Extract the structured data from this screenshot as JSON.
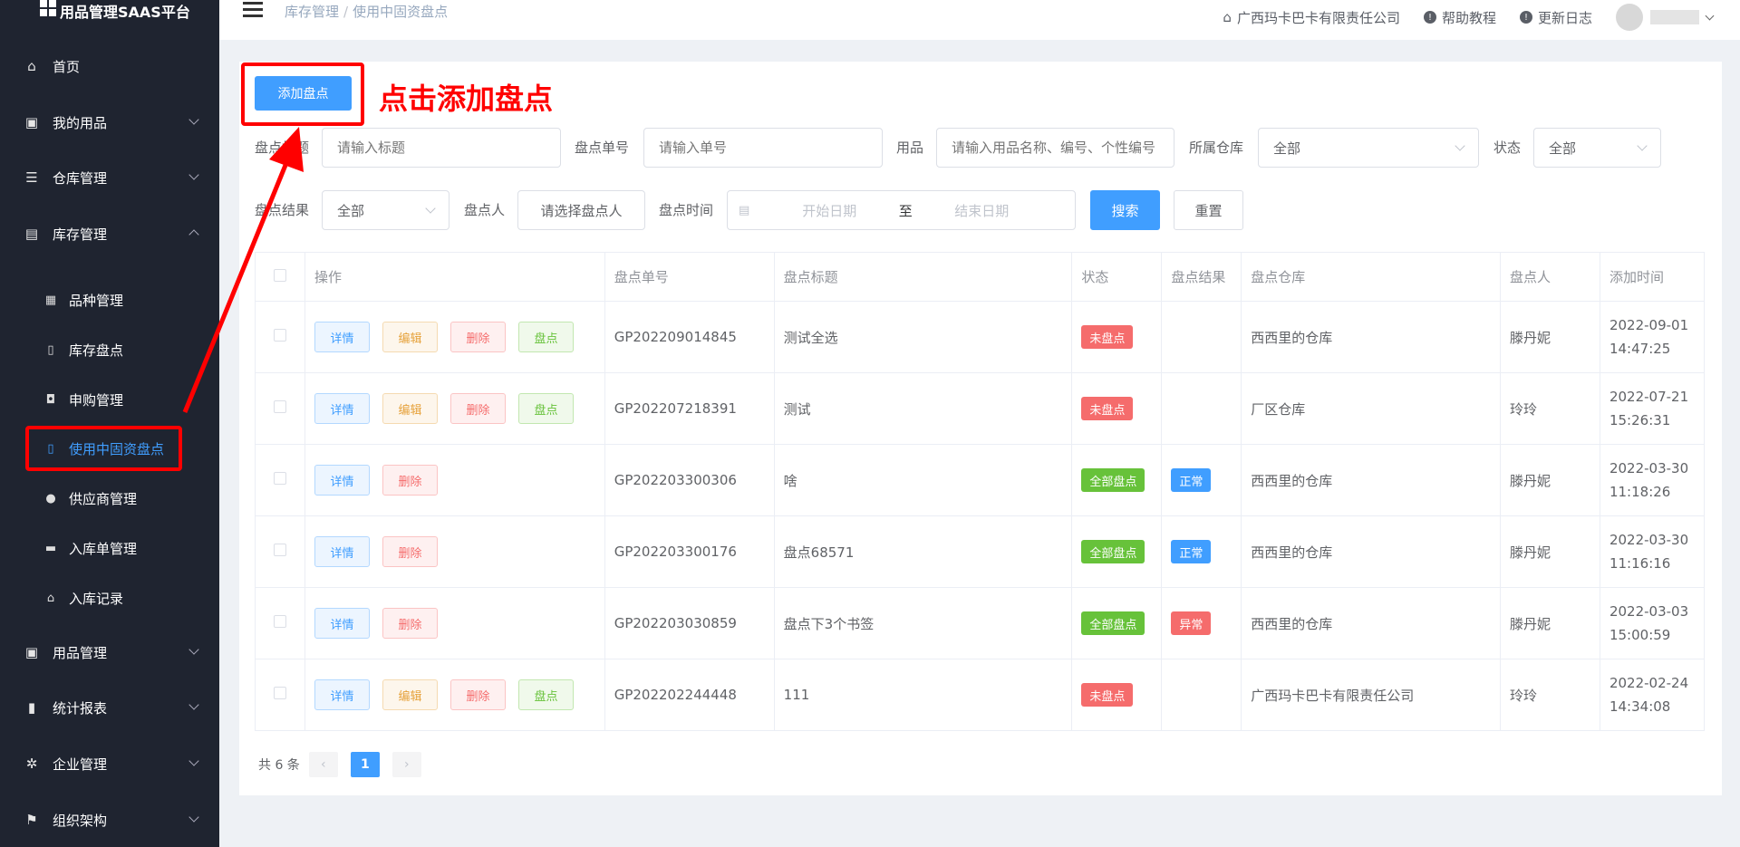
{
  "app": {
    "title": "用品管理SAAS平台"
  },
  "sidebar": {
    "items": [
      {
        "label": "首页",
        "icon": "home-icon"
      },
      {
        "label": "我的用品",
        "icon": "box-icon"
      },
      {
        "label": "仓库管理",
        "icon": "database-icon"
      },
      {
        "label": "库存管理",
        "icon": "inventory-icon"
      },
      {
        "label": "用品管理",
        "icon": "goods-icon"
      },
      {
        "label": "统计报表",
        "icon": "chart-icon"
      },
      {
        "label": "企业管理",
        "icon": "gear-icon"
      },
      {
        "label": "组织架构",
        "icon": "flag-icon"
      }
    ],
    "sub_items": [
      {
        "label": "品种管理",
        "icon": "grid-icon"
      },
      {
        "label": "库存盘点",
        "icon": "document-icon"
      },
      {
        "label": "申购管理",
        "icon": "bag-icon"
      },
      {
        "label": "使用中固资盘点",
        "icon": "document-icon"
      },
      {
        "label": "供应商管理",
        "icon": "user-icon"
      },
      {
        "label": "入库单管理",
        "icon": "printer-icon"
      },
      {
        "label": "入库记录",
        "icon": "home-icon"
      }
    ]
  },
  "header": {
    "breadcrumb": [
      "库存管理",
      "使用中固资盘点"
    ],
    "breadcrumb_sep": "/",
    "company": "广西玛卡巴卡有限责任公司",
    "help": "帮助教程",
    "changelog": "更新日志"
  },
  "annotation": {
    "text": "点击添加盘点",
    "color": "#ff0000"
  },
  "toolbar": {
    "add_label": "添加盘点"
  },
  "filters": {
    "title_label": "盘点标题",
    "title_placeholder": "请输入标题",
    "no_label": "盘点单号",
    "no_placeholder": "请输入单号",
    "goods_label": "用品",
    "goods_placeholder": "请输入用品名称、编号、个性编号",
    "warehouse_label": "所属仓库",
    "warehouse_value": "全部",
    "status_label": "状态",
    "status_value": "全部",
    "result_label": "盘点结果",
    "result_value": "全部",
    "person_label": "盘点人",
    "person_button": "请选择盘点人",
    "time_label": "盘点时间",
    "start_placeholder": "开始日期",
    "range_sep": "至",
    "end_placeholder": "结束日期",
    "search_label": "搜索",
    "reset_label": "重置"
  },
  "table": {
    "headers": [
      "操作",
      "盘点单号",
      "盘点标题",
      "状态",
      "盘点结果",
      "盘点仓库",
      "盘点人",
      "添加时间"
    ],
    "action_labels": {
      "detail": "详情",
      "edit": "编辑",
      "delete": "删除",
      "count": "盘点"
    },
    "rows": [
      {
        "no": "GP202209014845",
        "title": "测试全选",
        "status": "未盘点",
        "status_color": "red",
        "result": "",
        "result_color": "",
        "warehouse": "西西里的仓库",
        "person": "滕丹妮",
        "date": "2022-09-01",
        "time": "14:47:25",
        "actions": [
          "detail",
          "edit",
          "delete",
          "count"
        ]
      },
      {
        "no": "GP202207218391",
        "title": "测试",
        "status": "未盘点",
        "status_color": "red",
        "result": "",
        "result_color": "",
        "warehouse": "厂区仓库",
        "person": "玲玲",
        "date": "2022-07-21",
        "time": "15:26:31",
        "actions": [
          "detail",
          "edit",
          "delete",
          "count"
        ]
      },
      {
        "no": "GP202203300306",
        "title": "啥",
        "status": "全部盘点",
        "status_color": "green",
        "result": "正常",
        "result_color": "blue",
        "warehouse": "西西里的仓库",
        "person": "滕丹妮",
        "date": "2022-03-30",
        "time": "11:18:26",
        "actions": [
          "detail",
          "delete"
        ]
      },
      {
        "no": "GP202203300176",
        "title": "盘点68571",
        "status": "全部盘点",
        "status_color": "green",
        "result": "正常",
        "result_color": "blue",
        "warehouse": "西西里的仓库",
        "person": "滕丹妮",
        "date": "2022-03-30",
        "time": "11:16:16",
        "actions": [
          "detail",
          "delete"
        ]
      },
      {
        "no": "GP202203030859",
        "title": "盘点下3个书签",
        "status": "全部盘点",
        "status_color": "green",
        "result": "异常",
        "result_color": "red",
        "warehouse": "西西里的仓库",
        "person": "滕丹妮",
        "date": "2022-03-03",
        "time": "15:00:59",
        "actions": [
          "detail",
          "delete"
        ]
      },
      {
        "no": "GP202202244448",
        "title": "111",
        "status": "未盘点",
        "status_color": "red",
        "result": "",
        "result_color": "",
        "warehouse": "广西玛卡巴卡有限责任公司",
        "person": "玲玲",
        "date": "2022-02-24",
        "time": "14:34:08",
        "actions": [
          "detail",
          "edit",
          "delete",
          "count"
        ]
      }
    ]
  },
  "pagination": {
    "total_text": "共 6 条",
    "current_page": "1",
    "prev": "‹",
    "next": "›"
  }
}
